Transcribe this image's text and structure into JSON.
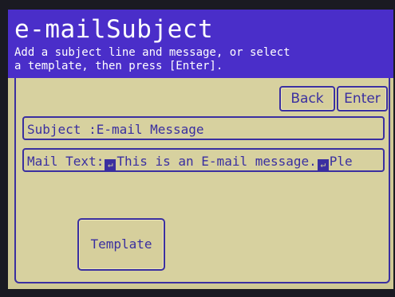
{
  "header": {
    "title": "e-mailSubject",
    "instruction_line1": "Add a subject line and message, or select",
    "instruction_line2": "a template, then press [Enter]."
  },
  "buttons": {
    "back_label": "Back",
    "enter_label": "Enter",
    "template_label": "Template"
  },
  "fields": {
    "subject": {
      "label": "Subject",
      "separator": " :",
      "value": "E-mail Message"
    },
    "mail_text": {
      "label": "Mail Text:",
      "value_part1": "This is an E-mail message.",
      "value_part2": "Ple"
    }
  },
  "icons": {
    "return_glyph": "↵"
  },
  "colors": {
    "header_bg": "#4a2ec9",
    "screen_bg": "#cfc994",
    "accent": "#3a2fa0"
  }
}
